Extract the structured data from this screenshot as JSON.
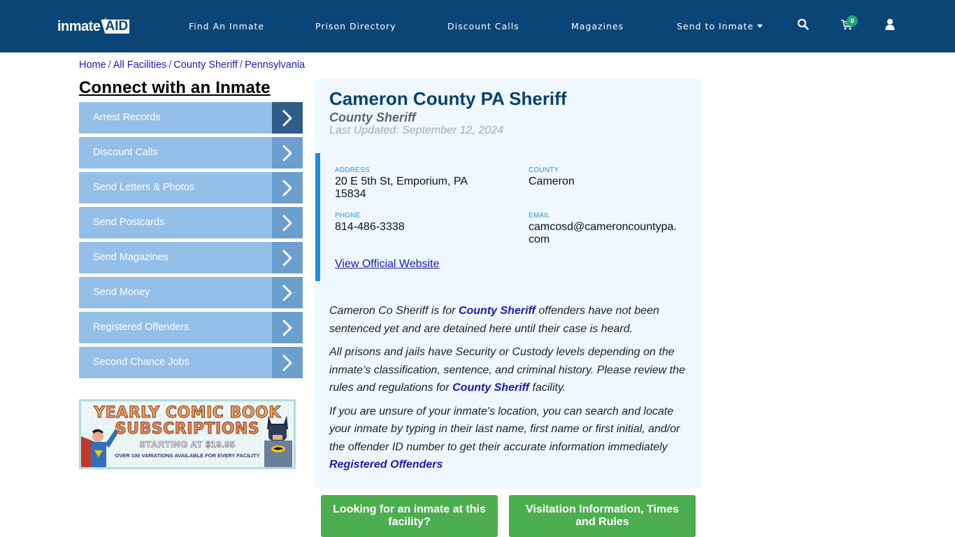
{
  "header": {
    "logo_text_left": "inmate",
    "logo_text_right": "AID",
    "logo_plus": "+",
    "nav": [
      {
        "label": "Find An Inmate"
      },
      {
        "label": "Prison Directory"
      },
      {
        "label": "Discount Calls"
      },
      {
        "label": "Magazines"
      },
      {
        "label": "Send to Inmate",
        "has_dropdown": true
      }
    ],
    "icons": [
      "search-icon",
      "cart-icon",
      "user-icon"
    ],
    "cart_count": "0"
  },
  "breadcrumb": [
    {
      "label": "Home"
    },
    {
      "label": "All Facilities"
    },
    {
      "label": "County Sheriff"
    },
    {
      "label": "Pennsylvania"
    }
  ],
  "breadcrumb_separator": "/",
  "sidebar": {
    "title": "Connect with an Inmate",
    "items": [
      {
        "label": "Arrest Records"
      },
      {
        "label": "Discount Calls"
      },
      {
        "label": "Send Letters & Photos"
      },
      {
        "label": "Send Postcards"
      },
      {
        "label": "Send Magazines"
      },
      {
        "label": "Send Money"
      },
      {
        "label": "Registered Offenders"
      },
      {
        "label": "Second Chance Jobs"
      }
    ],
    "ad": {
      "line1": "YEARLY COMIC BOOK",
      "line2": "SUBSCRIPTIONS",
      "line3": "STARTING AT $19.95",
      "line4": "OVER 100 VARIATIONS AVAILABLE FOR EVERY FACILITY"
    }
  },
  "facility": {
    "title": "Cameron County PA Sheriff",
    "type": "County Sheriff",
    "last_updated": "Last Updated: September 12, 2024",
    "address_label": "ADDRESS",
    "address": "20 E 5th St, Emporium, PA 15834",
    "county_label": "COUNTY",
    "county": "Cameron",
    "phone_label": "PHONE",
    "phone": "814-486-3338",
    "email_label": "EMAIL",
    "email": "camcosd@cameroncountypa.com",
    "website_link": "View Official Website"
  },
  "description": {
    "p1_a": "Cameron Co Sheriff is for ",
    "p1_link": "County Sheriff",
    "p1_b": " offenders have not been sentenced yet and are detained here until their case is heard.",
    "p2_a": "All prisons and jails have Security or Custody levels depending on the inmate’s classification, sentence, and criminal history. Please review the rules and regulations for ",
    "p2_link": "County Sheriff",
    "p2_b": " facility.",
    "p3": "If you are unsure of your inmate's location, you can search and locate your inmate by typing in their last name, first name or first initial, and/or the offender ID number to get their accurate information immediately",
    "p3_link": "Registered Offenders"
  },
  "buttons": {
    "find_inmate": "Looking for an inmate at this facility?",
    "visitation": "Visitation Information, Times and Rules"
  },
  "colors": {
    "header_bg": "#0b4577",
    "sidebar_item": "#94bfe8",
    "sidebar_arrow": "#6b9fd0",
    "sidebar_arrow_active": "#2f5d8a",
    "card_bg": "#eef8fe",
    "accent_bar": "#1a8fe8",
    "button_green": "#4cae4f",
    "link": "#1a1ab0"
  }
}
